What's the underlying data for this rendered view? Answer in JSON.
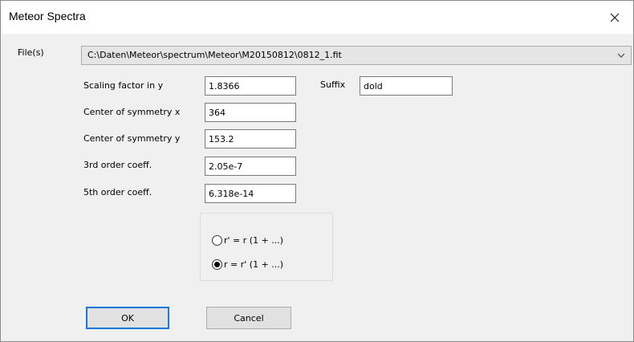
{
  "window": {
    "title": "Meteor Spectra"
  },
  "files": {
    "label": "File(s)",
    "selected": "C:\\Daten\\Meteor\\spectrum\\Meteor\\M20150812\\0812_1.fit"
  },
  "fields": {
    "scaling": {
      "label": "Scaling factor in y",
      "value": "1.8366"
    },
    "center_x": {
      "label": "Center of symmetry x",
      "value": "364"
    },
    "center_y": {
      "label": "Center of symmetry y",
      "value": "153.2"
    },
    "coeff3": {
      "label": "3rd order coeff.",
      "value": "2.05e-7"
    },
    "coeff5": {
      "label": "5th order coeff.",
      "value": "6.318e-14"
    },
    "suffix": {
      "label": "Suffix",
      "value": "dold"
    }
  },
  "radio": {
    "options": [
      {
        "label": "r' = r (1 + ...)",
        "checked": false
      },
      {
        "label": "r = r' (1 + ...)",
        "checked": true
      }
    ]
  },
  "buttons": {
    "ok": "OK",
    "cancel": "Cancel"
  }
}
